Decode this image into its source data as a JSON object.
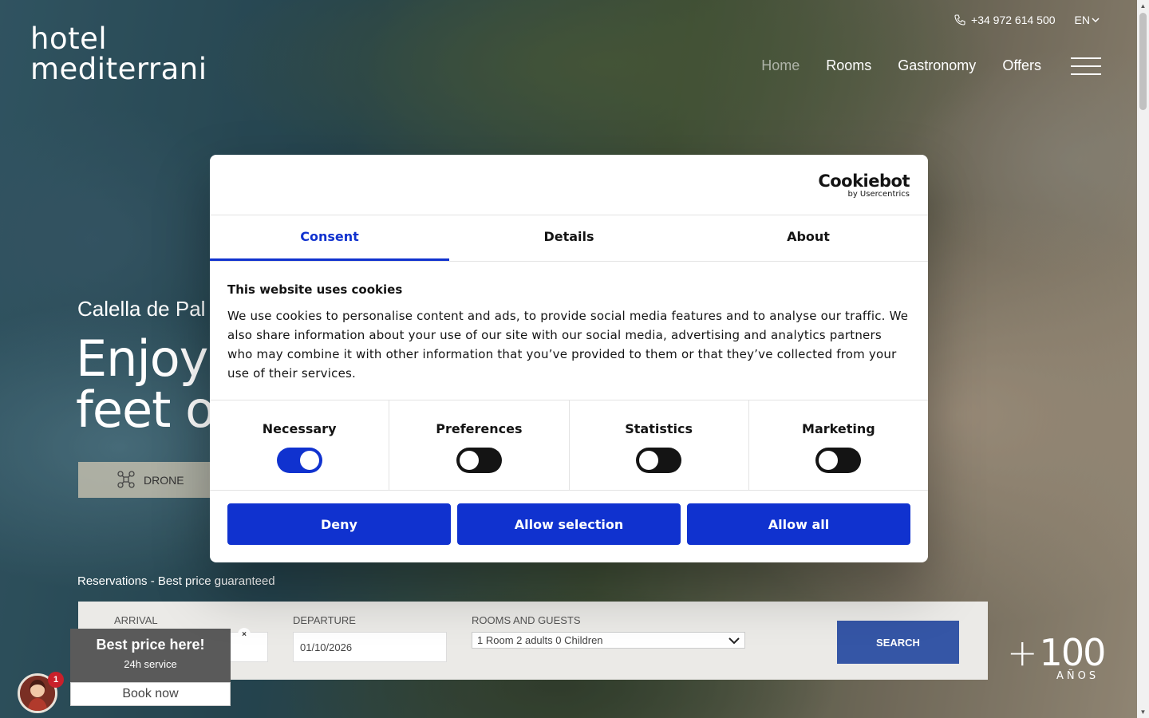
{
  "header": {
    "logo_line1": "hotel",
    "logo_line2": "mediterrani",
    "phone": "+34 972 614 500",
    "language": "EN",
    "nav": [
      {
        "label": "Home"
      },
      {
        "label": "Rooms"
      },
      {
        "label": "Gastronomy"
      },
      {
        "label": "Offers"
      }
    ]
  },
  "hero": {
    "subtitle": "Calella de Pal",
    "title_line1": "Enjoy t",
    "title_line2": "feet on",
    "drone_label": "DRONE"
  },
  "reservation": {
    "label": "Reservations - Best price guaranteed",
    "arrival_label": "ARRIVAL",
    "departure_label": "DEPARTURE",
    "departure_value": "01/10/2026",
    "rooms_label": "ROOMS AND GUESTS",
    "rooms_value": "1 Room 2 adults 0 Children",
    "search_label": "SEARCH"
  },
  "badge": {
    "number": "100",
    "caption": "AÑOS"
  },
  "chat": {
    "title": "Best price here!",
    "subtitle": "24h service",
    "book_label": "Book now",
    "close": "×",
    "count": "1"
  },
  "cookie": {
    "brand": "Cookiebot",
    "brand_by": "by Usercentrics",
    "tabs": [
      {
        "label": "Consent",
        "active": true
      },
      {
        "label": "Details",
        "active": false
      },
      {
        "label": "About",
        "active": false
      }
    ],
    "heading": "This website uses cookies",
    "text": "We use cookies to personalise content and ads, to provide social media features and to analyse our traffic. We also share information about your use of our site with our social media, advertising and analytics partners who may combine it with other information that you’ve provided to them or that they’ve collected from your use of their services.",
    "toggles": [
      {
        "label": "Necessary",
        "on": true
      },
      {
        "label": "Preferences",
        "on": false
      },
      {
        "label": "Statistics",
        "on": false
      },
      {
        "label": "Marketing",
        "on": false
      }
    ],
    "buttons": {
      "deny": "Deny",
      "allow_selection": "Allow selection",
      "allow_all": "Allow all"
    },
    "accent_color": "#1032cf"
  }
}
